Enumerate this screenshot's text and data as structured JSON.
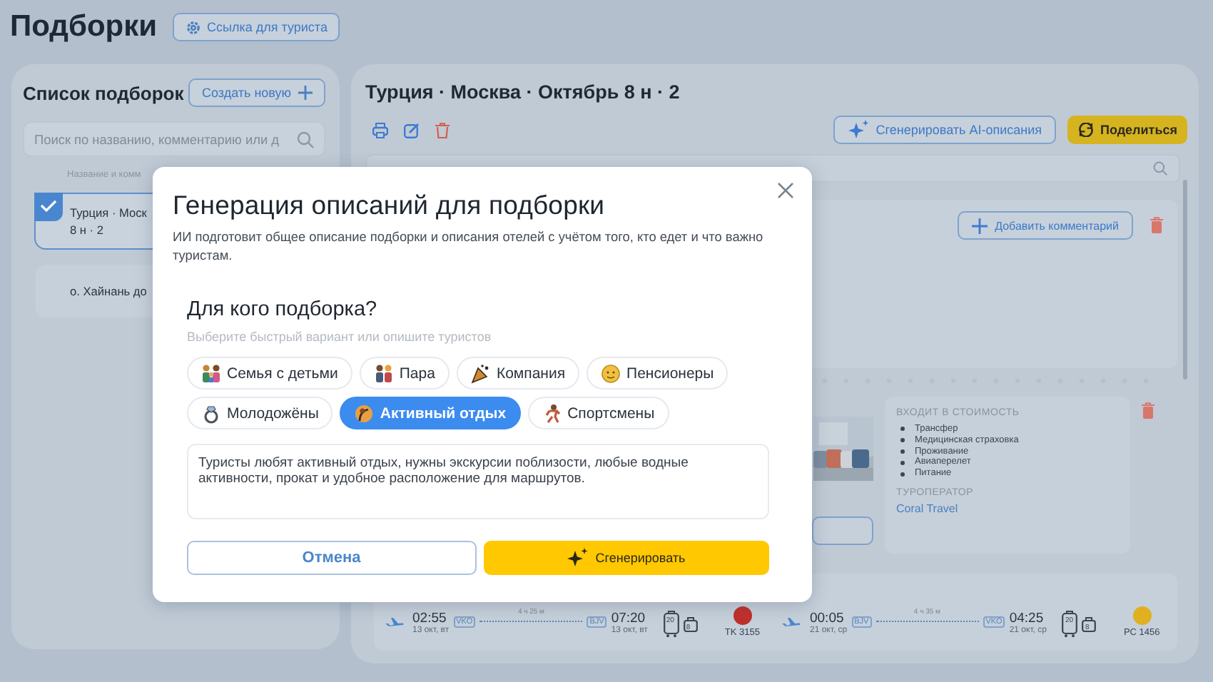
{
  "page": {
    "title": "Подборки",
    "tourist_link_button": "Ссылка для туриста"
  },
  "list_panel": {
    "title": "Список подборок",
    "create_button": "Создать новую",
    "search": {
      "placeholder": "Поиск по названию, комментарию или д"
    },
    "column_heading": "Название и комм",
    "items": [
      {
        "title": "Турция · Моск",
        "subtitle": "8 н · 2",
        "selected": true
      },
      {
        "title": "о. Хайнань до",
        "selected": false
      }
    ]
  },
  "detail_panel": {
    "title": "Турция · Москва · Октябрь 8 н · 2",
    "ai_button": "Сгенерировать AI-описания",
    "share_button": "Поделиться",
    "add_comment_button": "Добавить комментарий",
    "included": {
      "heading": "ВХОДИТ В СТОИМОСТЬ",
      "items": [
        "Трансфер",
        "Медицинская страховка",
        "Проживание",
        "Авиаперелет",
        "Питание"
      ]
    },
    "operator": {
      "heading": "ТУРОПЕРАТОР",
      "name": "Coral Travel"
    },
    "flights": [
      {
        "depart_time": "02:55",
        "depart_date": "13 окт, вт",
        "from": "VKO",
        "duration": "4 ч 25 м",
        "to": "BJV",
        "arrive_time": "07:20",
        "arrive_date": "13 окт, вт",
        "baggage": "20",
        "hand_luggage": "8",
        "flight_no": "TK 3155",
        "color": "#c0302c"
      },
      {
        "depart_time": "00:05",
        "depart_date": "21 окт, ср",
        "from": "BJV",
        "duration": "4 ч 35 м",
        "to": "VKO",
        "arrive_time": "04:25",
        "arrive_date": "21 окт, ср",
        "baggage": "20",
        "hand_luggage": "8",
        "flight_no": "PC 1456",
        "color": "#e0b020"
      }
    ]
  },
  "modal": {
    "title": "Генерация описаний для подборки",
    "description": "ИИ подготовит общее описание подборки и описания отелей с учётом того, кто едет и что важно туристам.",
    "question": "Для кого подборка?",
    "hint": "Выберите быстрый вариант или опишите туристов",
    "chips": [
      {
        "label": "Семья с детьми",
        "selected": false
      },
      {
        "label": "Пара",
        "selected": false
      },
      {
        "label": "Компания",
        "selected": false
      },
      {
        "label": "Пенсионеры",
        "selected": false
      },
      {
        "label": "Молодожёны",
        "selected": false
      },
      {
        "label": "Активный отдых",
        "selected": true
      },
      {
        "label": "Спортсмены",
        "selected": false
      }
    ],
    "tourists_text": "Туристы любят активный отдых, нужны экскурсии поблизости, любые водные активности, прокат и удобное расположение для маршрутов.",
    "cancel_button": "Отмена",
    "generate_button": "Сгенерировать"
  }
}
